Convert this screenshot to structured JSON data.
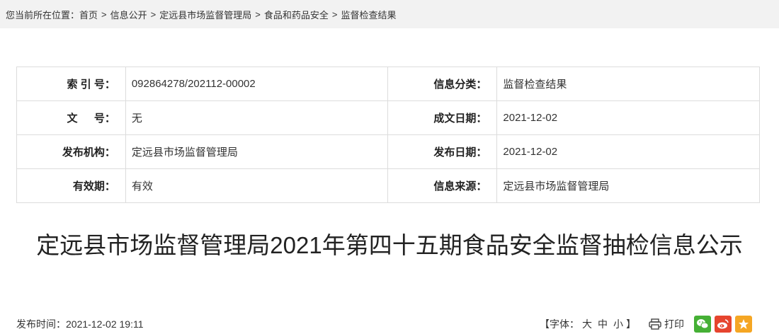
{
  "breadcrumb": {
    "prefix": "您当前所在位置：",
    "items": [
      "首页",
      "信息公开",
      "定远县市场监督管理局",
      "食品和药品安全",
      "监督检查结果"
    ],
    "separator": ">"
  },
  "meta": {
    "rows": [
      {
        "l1": "索 引 号：",
        "v1": "092864278/202112-00002",
        "l2": "信息分类：",
        "v2": "监督检查结果"
      },
      {
        "l1": "文 　 号：",
        "v1": "无",
        "l2": "成文日期：",
        "v2": "2021-12-02"
      },
      {
        "l1": "发布机构：",
        "v1": "定远县市场监督管理局",
        "l2": "发布日期：",
        "v2": "2021-12-02"
      },
      {
        "l1": "有效期：",
        "v1": "有效",
        "l2": "信息来源：",
        "v2": "定远县市场监督管理局"
      }
    ]
  },
  "article": {
    "title": "定远县市场监督管理局2021年第四十五期食品安全监督抽检信息公示",
    "publish_time": "发布时间：2021-12-02 19:11"
  },
  "tools": {
    "font_open": "【字体：",
    "font_large": "大",
    "font_medium": "中",
    "font_small": "小",
    "font_close": "】",
    "print_label": "打印"
  },
  "share": {
    "icons": [
      "wechat-icon",
      "weibo-icon",
      "favorite-icon"
    ],
    "colors": {
      "wechat": "#45b035",
      "weibo": "#e6442e",
      "favorite": "#f5a623"
    }
  }
}
